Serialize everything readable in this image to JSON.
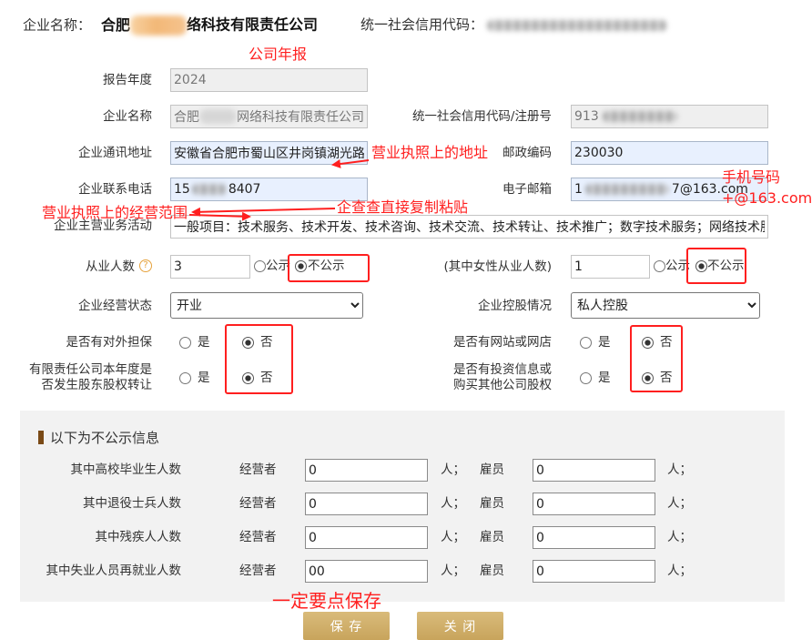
{
  "header": {
    "company_label": "企业名称：",
    "company_name_visible_start": "合肥",
    "company_name_visible_end": "络科技有限责任公司",
    "credit_code_label": "统一社会信用代码："
  },
  "form": {
    "report_year": {
      "label": "报告年度",
      "value": "2024"
    },
    "company_name": {
      "label": "企业名称",
      "value_start": "合肥",
      "value_end": "网络科技有限责任公司"
    },
    "credit_code": {
      "label": "统一社会信用代码/注册号",
      "value_start": "913"
    },
    "address": {
      "label": "企业通讯地址",
      "value": "安徽省合肥市蜀山区井岗镇湖光路"
    },
    "postal_code": {
      "label": "邮政编码",
      "value": "230030"
    },
    "phone": {
      "label": "企业联系电话",
      "value_start": "15",
      "value_end": "8407"
    },
    "email": {
      "label": "电子邮箱",
      "value_start": "1",
      "value_end": "7@163.com"
    },
    "main_business": {
      "label": "企业主营业务活动",
      "value": "一般项目：技术服务、技术开发、技术咨询、技术交流、技术转让、技术推广；数字技术服务；网络技术服"
    },
    "employees": {
      "label": "从业人数",
      "value": "3",
      "options": [
        "公示",
        "不公示"
      ],
      "selected": "不公示"
    },
    "female_employees": {
      "label": "(其中女性从业人数)",
      "value": "1",
      "options": [
        "公示",
        "不公示"
      ],
      "selected": "不公示"
    },
    "operating_status": {
      "label": "企业经营状态",
      "value": "开业"
    },
    "holding_status": {
      "label": "企业控股情况",
      "value": "私人控股"
    },
    "external_guarantee": {
      "label": "是否有对外担保",
      "options": [
        "是",
        "否"
      ],
      "selected": "否"
    },
    "website": {
      "label": "是否有网站或网店",
      "options": [
        "是",
        "否"
      ],
      "selected": "否"
    },
    "equity_transfer": {
      "label_lines": [
        "有限责任公司本年度是",
        "否发生股东股权转让"
      ],
      "options": [
        "是",
        "否"
      ],
      "selected": "否"
    },
    "investment": {
      "label_lines": [
        "是否有投资信息或",
        "购买其他公司股权"
      ],
      "options": [
        "是",
        "否"
      ],
      "selected": "否"
    }
  },
  "private_section": {
    "title": "以下为不公示信息",
    "operator_label": "经营者",
    "employee_label": "雇员",
    "unit": "人；",
    "rows": [
      {
        "label": "其中高校毕业生人数",
        "operator": "0",
        "employee": "0"
      },
      {
        "label": "其中退役士兵人数",
        "operator": "0",
        "employee": "0"
      },
      {
        "label": "其中残疾人人数",
        "operator": "0",
        "employee": "0"
      },
      {
        "label": "其中失业人员再就业人数",
        "operator": "00",
        "employee": "0"
      }
    ]
  },
  "buttons": {
    "save": "保 存",
    "close": "关 闭"
  },
  "annotations": {
    "title": "公司年报",
    "address_hint": "营业执照上的地址",
    "email_hint_line1": "手机号码",
    "email_hint_line2": "+@163.com",
    "copy_hint": "企查查直接复制粘贴",
    "scope_hint": "营业执照上的经营范围",
    "save_hint": "一定要点保存"
  },
  "icons": {
    "help": "help-icon"
  },
  "colors": {
    "annotation_red": "#ff1f1f",
    "button_gold_top": "#d9bb7a",
    "button_gold_bottom": "#c8a45c",
    "autofill_blue": "#e8f0fe",
    "section_bar_brown": "#7a4a16",
    "help_orange": "#e6a23c",
    "panel_gray": "#f2f2f2",
    "redaction_orange": "#f2b877"
  }
}
